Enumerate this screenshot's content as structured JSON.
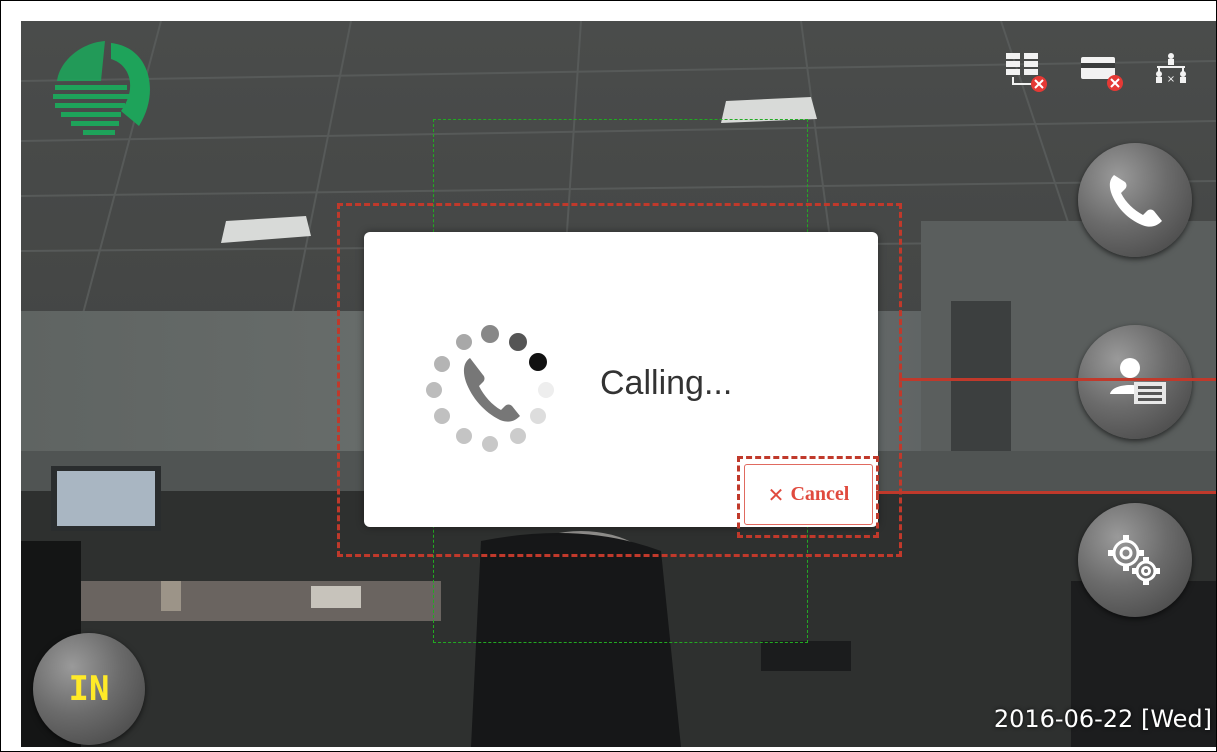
{
  "dialog": {
    "status_text": "Calling...",
    "cancel_label": "Cancel",
    "cancel_icon": "close-icon"
  },
  "mode_button": {
    "label": "IN"
  },
  "datetime": {
    "text": "2016-06-22 [Wed]"
  },
  "status_icons": [
    "server-error-icon",
    "card-error-icon",
    "network-icon"
  ],
  "side_buttons": [
    "phone-call-icon",
    "user-list-icon",
    "settings-gears-icon"
  ],
  "colors": {
    "annotation": "#c0392b",
    "cancel_text": "#e04a3e",
    "mode_text": "#ffea28",
    "face_box": "#22aa22",
    "logo": "#1ea35a",
    "status_error": "#e53935"
  }
}
